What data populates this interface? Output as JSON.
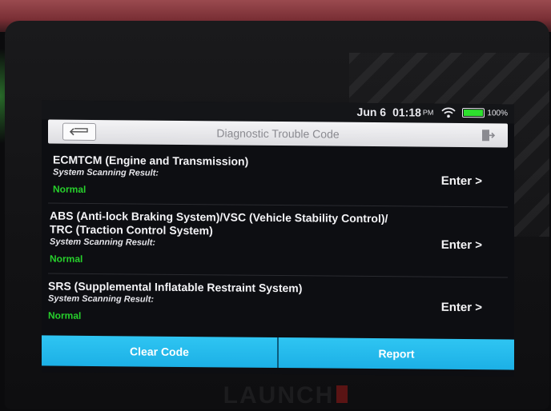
{
  "status_bar": {
    "date": "Jun 6",
    "time": "01:18",
    "ampm": "PM",
    "battery": "100%",
    "wifi_icon": "wifi-icon",
    "battery_icon": "battery-icon"
  },
  "header": {
    "title": "Diagnostic Trouble Code",
    "back_icon": "back-arrow-icon",
    "exit_icon": "exit-icon"
  },
  "systems": [
    {
      "name": "ECMTCM (Engine and Transmission)",
      "result_label": "System Scanning Result:",
      "result": "Normal",
      "action": "Enter >"
    },
    {
      "name_line1": "ABS (Anti-lock Braking System)/VSC (Vehicle Stability Control)/",
      "name_line2": "TRC (Traction Control System)",
      "result_label": "System Scanning Result:",
      "result": "Normal",
      "action": "Enter >"
    },
    {
      "name": "SRS (Supplemental Inflatable Restraint System)",
      "result_label": "System Scanning Result:",
      "result": "Normal",
      "action": "Enter >"
    }
  ],
  "footer": {
    "clear_label": "Clear Code",
    "report_label": "Report"
  },
  "device": {
    "brand": "LAUNCH"
  },
  "colors": {
    "accent": "#1cb0e6",
    "normal_status": "#27d12c",
    "screen_bg": "#0d0e12"
  }
}
